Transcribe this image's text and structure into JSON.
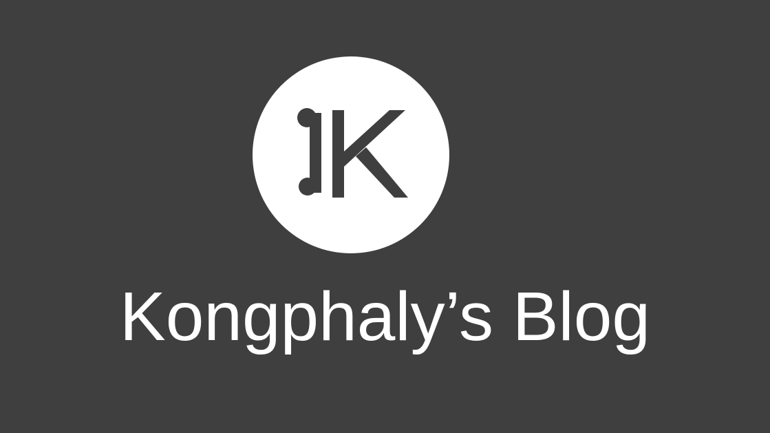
{
  "colors": {
    "background": "#3f3f3f",
    "logo_circle": "#ffffff",
    "logo_mark": "#3f3f3f",
    "title_text": "#ffffff"
  },
  "logo": {
    "icon": "jk-monogram-icon",
    "lettering": "JK"
  },
  "title": "Kongphaly’s Blog"
}
